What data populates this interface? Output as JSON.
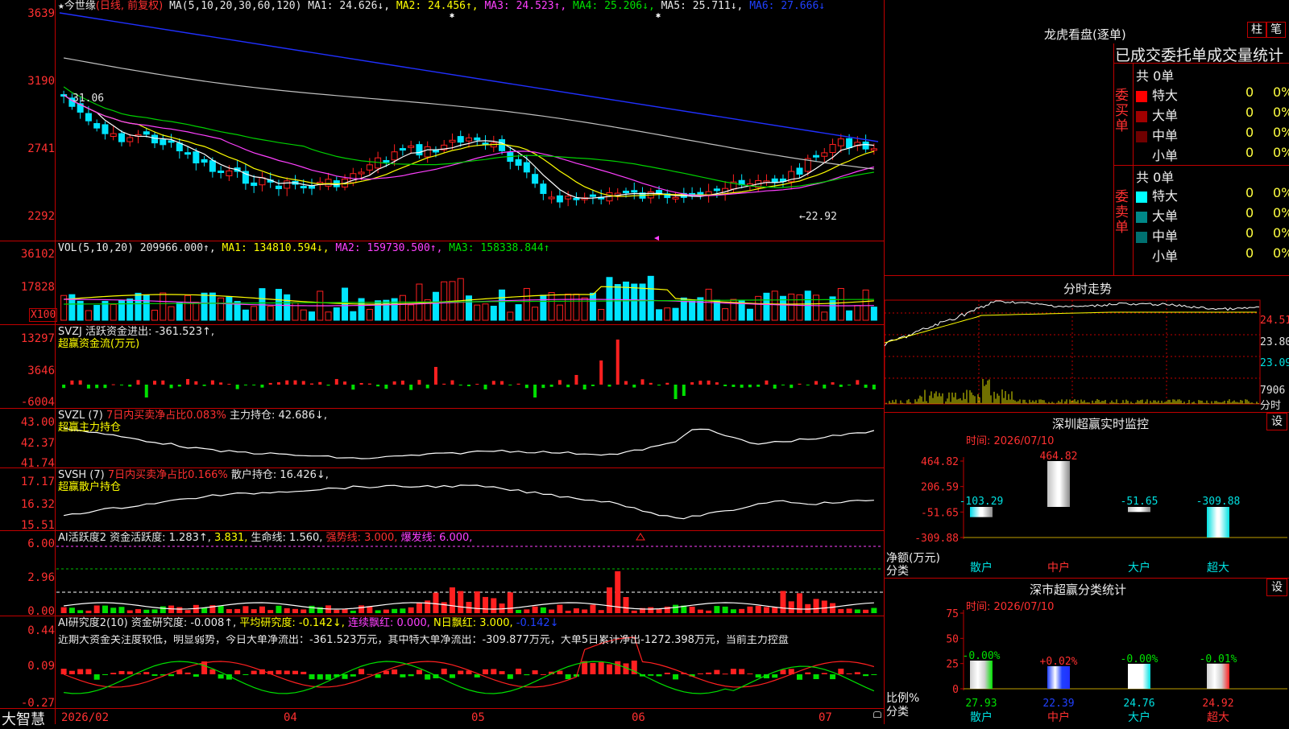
{
  "app": {
    "logo": "大智慧"
  },
  "main": {
    "header": {
      "star": "★",
      "stock": "今世缘",
      "mode": "(日线, 前复权)",
      "ma_label": "MA(5,10,20,30,60,120)",
      "ma1": "MA1: 24.626↓,",
      "ma2": "MA2: 24.456↑,",
      "ma3": "MA3: 24.523↑,",
      "ma4": "MA4: 25.206↓,",
      "ma5": "MA5: 25.711↓,",
      "ma6": "MA6: 27.666↓"
    },
    "y_ticks": [
      "3639",
      "3190",
      "2741",
      "2292"
    ],
    "high_label": "31.06",
    "low_label": "←22.92",
    "x_labels": [
      "2026/02",
      "04",
      "05",
      "06",
      "07"
    ]
  },
  "vol": {
    "header_label": "VOL(5,10,20)",
    "vol": "209966.000↑,",
    "ma1": "MA1: 134810.594↓,",
    "ma2": "MA2: 159730.500↑,",
    "ma3": "MA3: 158338.844↑",
    "y_ticks": [
      "36102",
      "17828"
    ],
    "unit": "X100"
  },
  "svzj": {
    "line1": "SVZJ  活跃资金进出: -361.523↑,",
    "line2": "超赢资金流(万元)",
    "y_ticks": [
      "13297",
      "3646",
      "-6004"
    ]
  },
  "svzl": {
    "name": "SVZL (7)",
    "ratio": "7日内买卖净占比0.083%",
    "hold": "主力持仓: 42.686↓,",
    "line2": "超赢主力持仓",
    "y_ticks": [
      "43.00",
      "42.37",
      "41.74"
    ]
  },
  "svsh": {
    "name": "SVSH (7)",
    "ratio": "7日内买卖净占比0.166%",
    "hold": "散户持仓: 16.426↓,",
    "line2": "超赢散户持仓",
    "y_ticks": [
      "17.17",
      "16.32",
      "15.51"
    ]
  },
  "ai_act": {
    "name": "AI活跃度2",
    "a": "资金活跃度: 1.283↑,",
    "b": "3.831,",
    "c": "生命线: 1.560,",
    "d": "强势线: 3.000,",
    "e": "爆发线: 6.000,",
    "y_ticks": [
      "6.00",
      "2.96",
      "0.00"
    ]
  },
  "ai_res": {
    "name": "AI研究度2(10)",
    "a": "资金研究度: -0.008↑,",
    "b": "平均研究度: -0.142↓,",
    "c": "连续飘红: 0.000,",
    "d": "N日飘红: 3.000,",
    "e": "-0.142↓",
    "comment": "近期大资金关注度较低，明显弱势，今日大单净流出：-361.523万元，其中特大单净流出：-309.877万元，大单5日累计净出-1272.398万元，当前主力控盘",
    "y_ticks": [
      "0.44",
      "0.09",
      "-0.27"
    ]
  },
  "right": {
    "lhb_title": "龙虎看盘(逐单)",
    "btn_bar": "柱",
    "btn_pen": "笔",
    "stats_title": "已成交委托单成交量统计",
    "buy_label": "委买单",
    "sell_label": "委卖单",
    "buy_total": "共 0单",
    "sell_total": "共 0单",
    "buy_rows": [
      {
        "name": "特大",
        "val": "0",
        "pct": "0%",
        "color": "#ff0000"
      },
      {
        "name": "大单",
        "val": "0",
        "pct": "0%",
        "color": "#a00000"
      },
      {
        "name": "中单",
        "val": "0",
        "pct": "0%",
        "color": "#700000"
      },
      {
        "name": "小单",
        "val": "0",
        "pct": "0%",
        "color": ""
      }
    ],
    "sell_rows": [
      {
        "name": "特大",
        "val": "0",
        "pct": "0%",
        "color": "#00ffff"
      },
      {
        "name": "大单",
        "val": "0",
        "pct": "0%",
        "color": "#008888"
      },
      {
        "name": "中单",
        "val": "0",
        "pct": "0%",
        "color": "#007070"
      },
      {
        "name": "小单",
        "val": "0",
        "pct": "0%",
        "color": ""
      }
    ],
    "intraday_title": "分时走势",
    "intraday_prices": [
      "24.51",
      "23.80",
      "23.09"
    ],
    "intraday_vol": "7906",
    "intraday_unit": "分时",
    "sz_title": "深圳超赢实时监控",
    "sz_set": "设",
    "sz_time": "时间: 2026/07/10",
    "sz_ticks": [
      "464.82",
      "206.59",
      "-51.65",
      "-309.88"
    ],
    "sz_axis_label": "净额(万元)",
    "sz_cat_label": "分类",
    "sz_values": [
      "-103.29",
      "464.82",
      "-51.65",
      "-309.88"
    ],
    "sz_cats": [
      "散户",
      "中户",
      "大户",
      "超大"
    ],
    "sc_title": "深市超赢分类统计",
    "sc_set": "设",
    "sc_time": "时间: 2026/07/10",
    "sc_ticks": [
      "75",
      "50",
      "25",
      "0"
    ],
    "sc_axis_label": "比例%",
    "sc_cat_label": "分类",
    "sc_changes": [
      "-0.00%",
      "+0.02%",
      "-0.00%",
      "-0.01%"
    ],
    "sc_values": [
      "27.93",
      "22.39",
      "24.76",
      "24.92"
    ],
    "sc_cats": [
      "散户",
      "中户",
      "大户",
      "超大"
    ]
  },
  "chart_data": [
    {
      "type": "bar",
      "title": "深圳超赢实时监控",
      "categories": [
        "散户",
        "中户",
        "大户",
        "超大"
      ],
      "values": [
        -103.29,
        464.82,
        -51.65,
        -309.88
      ],
      "ylabel": "净额(万元)",
      "xlabel": "分类",
      "ylim": [
        -309.88,
        464.82
      ]
    },
    {
      "type": "bar",
      "title": "深市超赢分类统计",
      "categories": [
        "散户",
        "中户",
        "大户",
        "超大"
      ],
      "values": [
        27.93,
        22.39,
        24.76,
        24.92
      ],
      "ylabel": "比例%",
      "xlabel": "分类",
      "ylim": [
        0,
        75
      ]
    }
  ]
}
